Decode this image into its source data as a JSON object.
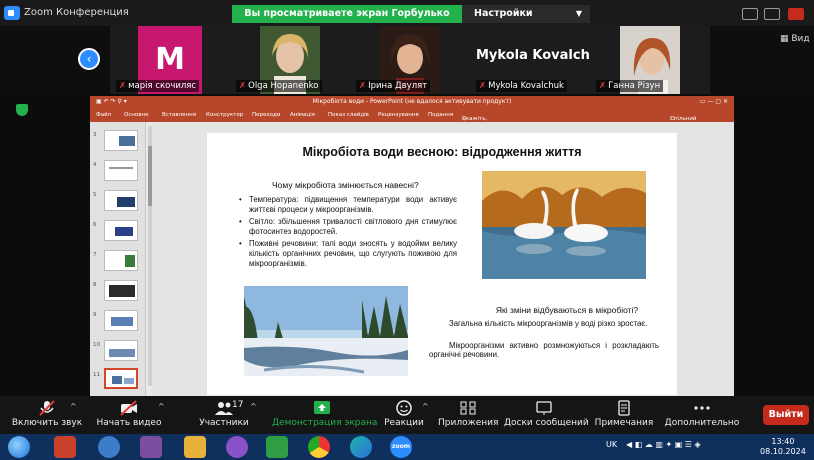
{
  "window": {
    "title": "Zoom Конференция",
    "share_banner": "Вы просматриваете экран Горбулько Анастасія",
    "view_settings": "Настройки просмотра",
    "view_label": "Вид"
  },
  "participants": [
    {
      "name": "марія скочиляс",
      "initial": "M"
    },
    {
      "name": "Olga Hopanenko"
    },
    {
      "name": "Ірина Двулят"
    },
    {
      "name": "Mykola Kovalchuk",
      "display": "Mykola Kovalch..."
    },
    {
      "name": "Ганна Різун"
    }
  ],
  "ppt": {
    "title": "Мікробіота води - PowerPoint (не вдалося активувати продукт)",
    "tabs": [
      "Файл",
      "Основне",
      "Вставлення",
      "Конструктор",
      "Переходи",
      "Анімація",
      "Показ слайдів",
      "Рецензування",
      "Подання"
    ],
    "search_hint": "Скажіть, що потрібно зробити...",
    "share_label": "Спільний доступ",
    "slide_numbers": [
      "3",
      "4",
      "5",
      "6",
      "7",
      "8",
      "9",
      "10",
      "11"
    ]
  },
  "slide": {
    "title": "Мікробіота води весною: відродження життя",
    "question1": "Чому мікробіота змінюється навесні?",
    "bullets": [
      "Температура: підвищення температури води активує життєві процеси у мікроорганізмів.",
      "Світло: збільшення тривалості світлового дня стимулює фотосинтез водоростей.",
      "Поживні речовини: талі води зносять у водойми велику кількість органічних речовин, що слугують поживою для мікроорганізмів."
    ],
    "question2": "Які зміни відбуваються в мікробіоті?",
    "para1": "Загальна кількість мікроорганізмів у воді різко зростає.",
    "para2": "Мікроорганізми активно розмножуються і розкладають органічні речовини."
  },
  "controls": {
    "mute": "Включить звук",
    "video": "Начать видео",
    "participants": "Участники",
    "participants_count": "17",
    "share": "Демонстрация экрана",
    "reactions": "Реакции",
    "apps": "Приложения",
    "whiteboards": "Доски сообщений",
    "notes": "Примечания",
    "more": "Дополнительно",
    "leave": "Выйти"
  },
  "taskbar": {
    "lang": "UK",
    "time": "13:40",
    "date": "08.10.2024",
    "zoom_label": "zoom"
  },
  "colors": {
    "share_green": "#23b14d",
    "ppt_red": "#b7472a",
    "zoom_blue": "#2d8cff",
    "leave_red": "#c42b1c"
  }
}
